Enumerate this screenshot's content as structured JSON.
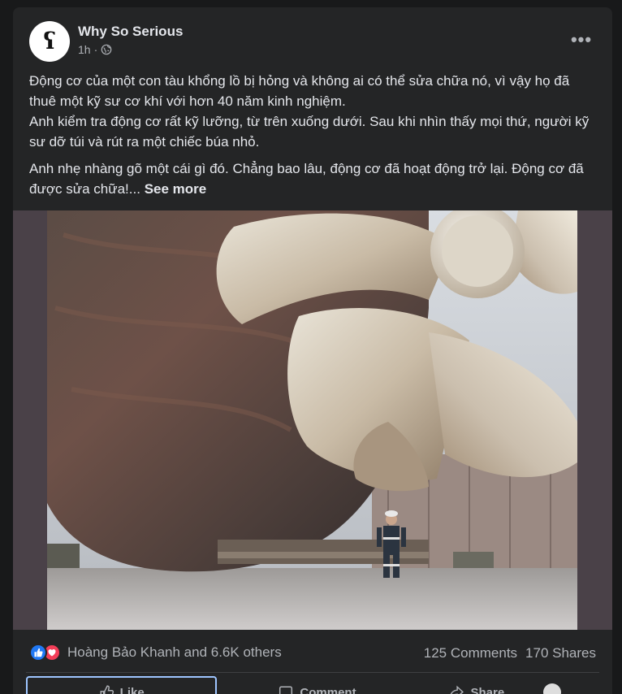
{
  "post": {
    "page_name": "Why So Serious",
    "avatar_glyph": "ʕ",
    "time": "1h",
    "visibility_icon": "globe-icon",
    "more_icon": "more-options-icon",
    "more_label": "•••",
    "paragraphs": [
      "Động cơ của một con tàu khổng lồ bị hỏng và không ai có thể sửa chữa nó, vì vậy họ đã thuê một kỹ sư cơ khí với hơn 40 năm kinh nghiệm.",
      "Anh kiểm tra động cơ rất kỹ lưỡng, từ trên xuống dưới. Sau khi nhìn thấy mọi thứ, người kỹ sư dỡ túi và rút ra một chiếc búa nhỏ.",
      "Anh nhẹ nhàng gõ một cái gì đó. Chẳng bao lâu, động cơ đã hoạt động trở lại. Động cơ đã được sửa chữa!..."
    ],
    "see_more": "See more",
    "image_alt": "Giant ship propeller in dry dock with a worker standing beneath it"
  },
  "stats": {
    "reactions_text": "Hoàng Bảo Khanh and 6.6K others",
    "comments": "125 Comments",
    "shares": "170 Shares"
  },
  "actions": {
    "like": "Like",
    "comment": "Comment",
    "share": "Share"
  },
  "colors": {
    "background": "#18191a",
    "card": "#242526",
    "text_primary": "#e4e6eb",
    "text_secondary": "#b0b3b8",
    "like_blue": "#2078f4",
    "love_red": "#f33e58"
  }
}
